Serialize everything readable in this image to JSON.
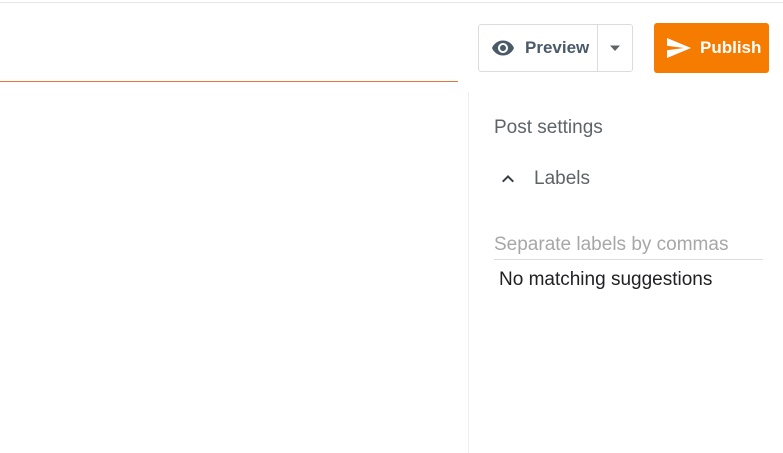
{
  "toolbar": {
    "preview": {
      "label": "Preview",
      "icon": "eye-icon",
      "dropdown_icon": "caret-down-icon"
    },
    "publish": {
      "label": "Publish",
      "icon": "send-icon",
      "color": "#f57c00"
    }
  },
  "sidebar": {
    "heading": "Post settings",
    "labels_section": {
      "title": "Labels",
      "expanded": true,
      "toggle_icon": "chevron-up-icon",
      "input": {
        "value": "",
        "placeholder": "Separate labels by commas"
      },
      "suggestions_message": "No matching suggestions"
    }
  },
  "colors": {
    "accent": "#f57c00",
    "title_underline": "#e8733a",
    "secondary_text": "#5f6368"
  }
}
